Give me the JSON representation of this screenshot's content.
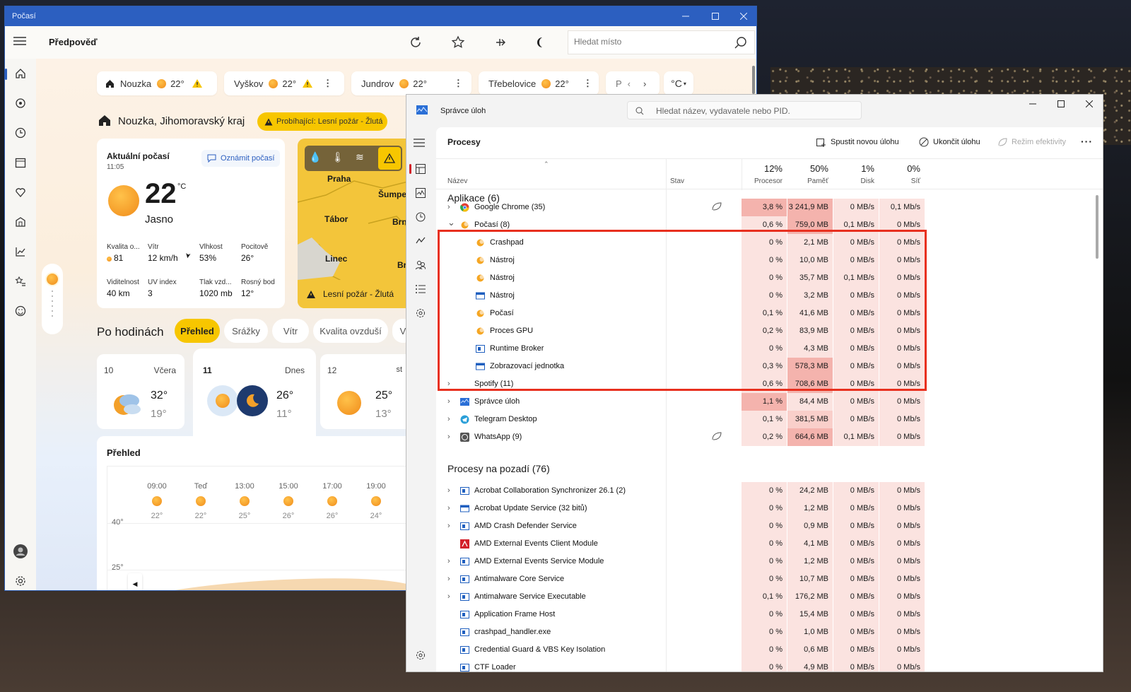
{
  "weather": {
    "title": "Počasí",
    "header": "Předpověď",
    "search_placeholder": "Hledat místo",
    "locations": [
      {
        "name": "Nouzka",
        "temp": "22°",
        "warn": true
      },
      {
        "name": "Vyškov",
        "temp": "22°",
        "warn": true
      },
      {
        "name": "Jundrov",
        "temp": "22°",
        "warn": false
      },
      {
        "name": "Třebelovice",
        "temp": "22°",
        "warn": false
      }
    ],
    "loc_more": "P",
    "unit": "°C",
    "place": "Nouzka, Jihomoravský kraj",
    "alert": "Probíhající: Lesní požár - Žlutá",
    "current": {
      "title": "Aktuální počasí",
      "time": "11:05",
      "report": "Oznámit počasí",
      "temp": "22",
      "deg": "°C",
      "cond": "Jasno",
      "items": [
        {
          "label": "Kvalita o...",
          "value": "81"
        },
        {
          "label": "Vítr",
          "value": "12 km/h"
        },
        {
          "label": "Vlhkost",
          "value": "53%"
        },
        {
          "label": "Pocitově",
          "value": "26°"
        },
        {
          "label": "Viditelnost",
          "value": "40 km"
        },
        {
          "label": "UV index",
          "value": "3"
        },
        {
          "label": "Tlak vzd...",
          "value": "1020 mb"
        },
        {
          "label": "Rosný bod",
          "value": "12°"
        }
      ]
    },
    "map": {
      "cities": [
        "Praha",
        "Šumper",
        "Tábor",
        "Brno",
        "Linec",
        "Bra"
      ],
      "alert": "Lesní požár - Žlutá"
    },
    "hourly": {
      "title": "Po hodinách",
      "tabs": [
        "Přehled",
        "Srážky",
        "Vítr",
        "Kvalita ovzduší",
        "V"
      ]
    },
    "days": [
      {
        "day": "10",
        "name": "Včera",
        "hi": "32°",
        "lo": "19°"
      },
      {
        "day": "11",
        "name": "Dnes",
        "hi": "26°",
        "lo": "11°"
      },
      {
        "day": "12",
        "name": "st",
        "hi": "25°",
        "lo": "13°"
      }
    ],
    "overview": {
      "title": "Přehled",
      "yaxis": [
        "40°",
        "25°"
      ],
      "times": [
        "09:00",
        "Teď",
        "13:00",
        "15:00",
        "17:00",
        "19:00"
      ],
      "temps": [
        "22°",
        "22°",
        "25°",
        "26°",
        "26°",
        "24°"
      ]
    }
  },
  "taskmgr": {
    "title": "Správce úloh",
    "search": "Hledat název, vydavatele nebo PID.",
    "section": "Procesy",
    "actions": {
      "run": "Spustit novou úlohu",
      "end": "Ukončit úlohu",
      "eff": "Režim efektivity"
    },
    "columns": {
      "name": "Název",
      "status": "Stav",
      "cpu_pct": "12%",
      "cpu": "Procesor",
      "mem_pct": "50%",
      "mem": "Paměť",
      "disk_pct": "1%",
      "disk": "Disk",
      "net_pct": "0%",
      "net": "Síť"
    },
    "group_apps": "Aplikace (6)",
    "group_bg": "Procesy na pozadí (76)",
    "apps": [
      {
        "name": "Google Chrome (35)",
        "cpu": "3,8 %",
        "mem": "3 241,9 MB",
        "disk": "0 MB/s",
        "net": "0,1 Mb/s",
        "icon": "chrome-icon",
        "exp": ">",
        "indent": 0,
        "leaf": true
      },
      {
        "name": "Počasí (8)",
        "cpu": "0,6 %",
        "mem": "759,0 MB",
        "disk": "0,1 MB/s",
        "net": "0 Mb/s",
        "icon": "weather-icon",
        "exp": "v",
        "indent": 0
      },
      {
        "name": "Crashpad",
        "cpu": "0 %",
        "mem": "2,1 MB",
        "disk": "0 MB/s",
        "net": "0 Mb/s",
        "icon": "weather-icon",
        "exp": "",
        "indent": 1
      },
      {
        "name": "Nástroj",
        "cpu": "0 %",
        "mem": "10,0 MB",
        "disk": "0 MB/s",
        "net": "0 Mb/s",
        "icon": "weather-icon",
        "exp": "",
        "indent": 1
      },
      {
        "name": "Nástroj",
        "cpu": "0 %",
        "mem": "35,7 MB",
        "disk": "0,1 MB/s",
        "net": "0 Mb/s",
        "icon": "weather-icon",
        "exp": "",
        "indent": 1
      },
      {
        "name": "Nástroj",
        "cpu": "0 %",
        "mem": "3,2 MB",
        "disk": "0 MB/s",
        "net": "0 Mb/s",
        "icon": "window-icon",
        "exp": "",
        "indent": 1
      },
      {
        "name": "Počasí",
        "cpu": "0,1 %",
        "mem": "41,6 MB",
        "disk": "0 MB/s",
        "net": "0 Mb/s",
        "icon": "weather-icon",
        "exp": "",
        "indent": 1
      },
      {
        "name": "Proces GPU",
        "cpu": "0,2 %",
        "mem": "83,9 MB",
        "disk": "0 MB/s",
        "net": "0 Mb/s",
        "icon": "weather-icon",
        "exp": "",
        "indent": 1
      },
      {
        "name": "Runtime Broker",
        "cpu": "0 %",
        "mem": "4,3 MB",
        "disk": "0 MB/s",
        "net": "0 Mb/s",
        "icon": "app-icon",
        "exp": "",
        "indent": 1
      },
      {
        "name": "Zobrazovací jednotka",
        "cpu": "0,3 %",
        "mem": "578,3 MB",
        "disk": "0 MB/s",
        "net": "0 Mb/s",
        "icon": "window-icon",
        "exp": "",
        "indent": 1
      },
      {
        "name": "Spotify (11)",
        "cpu": "0,6 %",
        "mem": "708,6 MB",
        "disk": "0 MB/s",
        "net": "0 Mb/s",
        "icon": "",
        "exp": ">",
        "indent": 0
      },
      {
        "name": "Správce úloh",
        "cpu": "1,1 %",
        "mem": "84,4 MB",
        "disk": "0 MB/s",
        "net": "0 Mb/s",
        "icon": "taskmgr-icon",
        "exp": ">",
        "indent": 0
      },
      {
        "name": "Telegram Desktop",
        "cpu": "0,1 %",
        "mem": "381,5 MB",
        "disk": "0 MB/s",
        "net": "0 Mb/s",
        "icon": "telegram-icon",
        "exp": ">",
        "indent": 0
      },
      {
        "name": "WhatsApp (9)",
        "cpu": "0,2 %",
        "mem": "664,6 MB",
        "disk": "0,1 MB/s",
        "net": "0 Mb/s",
        "icon": "whatsapp-icon",
        "exp": ">",
        "indent": 0,
        "leaf": true
      }
    ],
    "background": [
      {
        "name": "Acrobat Collaboration Synchronizer 26.1 (2)",
        "cpu": "0 %",
        "mem": "24,2 MB",
        "disk": "0 MB/s",
        "net": "0 Mb/s",
        "icon": "app-icon",
        "exp": ">"
      },
      {
        "name": "Acrobat Update Service (32 bitů)",
        "cpu": "0 %",
        "mem": "1,2 MB",
        "disk": "0 MB/s",
        "net": "0 Mb/s",
        "icon": "window-icon",
        "exp": ">"
      },
      {
        "name": "AMD Crash Defender Service",
        "cpu": "0 %",
        "mem": "0,9 MB",
        "disk": "0 MB/s",
        "net": "0 Mb/s",
        "icon": "app-icon",
        "exp": ">"
      },
      {
        "name": "AMD External Events Client Module",
        "cpu": "0 %",
        "mem": "4,1 MB",
        "disk": "0 MB/s",
        "net": "0 Mb/s",
        "icon": "amd-icon",
        "exp": ""
      },
      {
        "name": "AMD External Events Service Module",
        "cpu": "0 %",
        "mem": "1,2 MB",
        "disk": "0 MB/s",
        "net": "0 Mb/s",
        "icon": "app-icon",
        "exp": ">"
      },
      {
        "name": "Antimalware Core Service",
        "cpu": "0 %",
        "mem": "10,7 MB",
        "disk": "0 MB/s",
        "net": "0 Mb/s",
        "icon": "app-icon",
        "exp": ">"
      },
      {
        "name": "Antimalware Service Executable",
        "cpu": "0,1 %",
        "mem": "176,2 MB",
        "disk": "0 MB/s",
        "net": "0 Mb/s",
        "icon": "app-icon",
        "exp": ">"
      },
      {
        "name": "Application Frame Host",
        "cpu": "0 %",
        "mem": "15,4 MB",
        "disk": "0 MB/s",
        "net": "0 Mb/s",
        "icon": "app-icon",
        "exp": ""
      },
      {
        "name": "crashpad_handler.exe",
        "cpu": "0 %",
        "mem": "1,0 MB",
        "disk": "0 MB/s",
        "net": "0 Mb/s",
        "icon": "app-icon",
        "exp": ""
      },
      {
        "name": "Credential Guard & VBS Key Isolation",
        "cpu": "0 %",
        "mem": "0,6 MB",
        "disk": "0 MB/s",
        "net": "0 Mb/s",
        "icon": "app-icon",
        "exp": ""
      },
      {
        "name": "CTF Loader",
        "cpu": "0 %",
        "mem": "4,9 MB",
        "disk": "0 MB/s",
        "net": "0 Mb/s",
        "icon": "app-icon",
        "exp": ""
      }
    ],
    "colors": {
      "highlight": "#e8301f",
      "heat_hi": "#f4b3ad",
      "heat_mid": "#f9cfca",
      "heat_lo": "#fbe3e0"
    }
  }
}
